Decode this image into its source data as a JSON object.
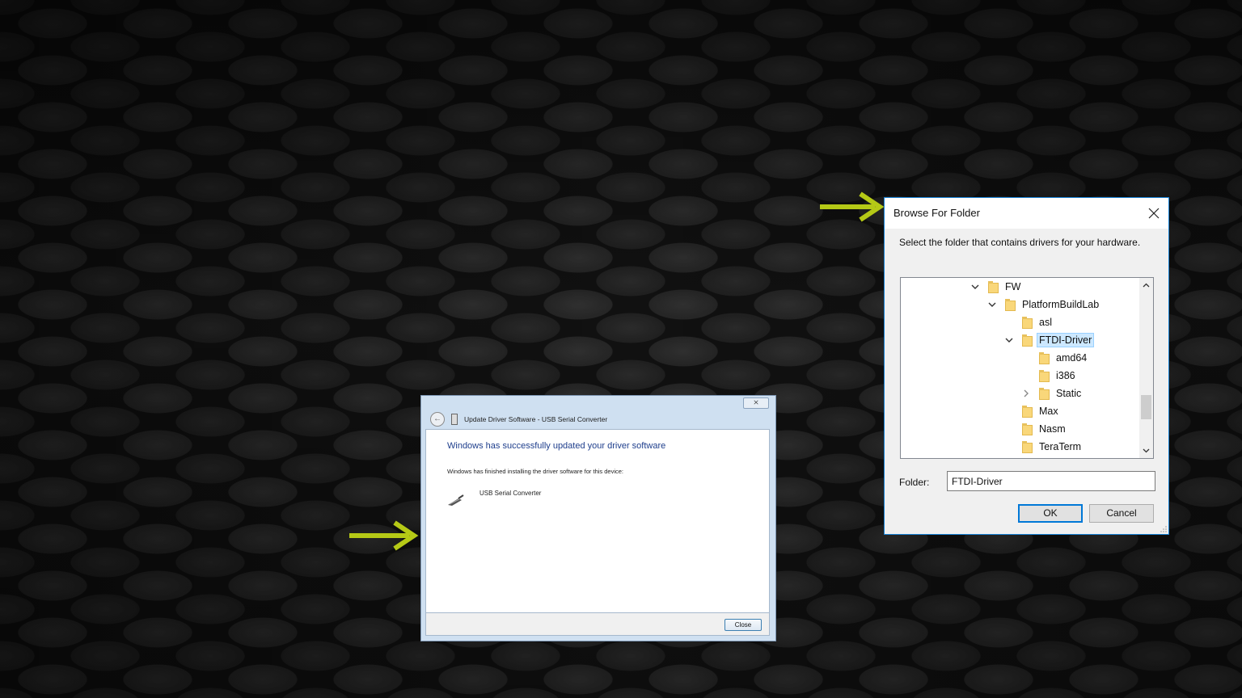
{
  "colors": {
    "arrow": "#b5c916",
    "win10_accent": "#0078d7",
    "win7_heading": "#1e3e8c"
  },
  "update_dialog": {
    "title": "Update Driver Software - USB Serial Converter",
    "heading": "Windows has successfully updated your driver software",
    "message": "Windows has finished installing the driver software for this device:",
    "device_name": "USB Serial Converter",
    "device_icon": "usb-cable-icon",
    "close_label": "Close",
    "close_icon": "close-icon"
  },
  "browse_dialog": {
    "title": "Browse For Folder",
    "description": "Select the folder that contains drivers for your hardware.",
    "tree": [
      {
        "label": "FW",
        "level": 0,
        "expander": "expanded",
        "selected": false
      },
      {
        "label": "PlatformBuildLab",
        "level": 1,
        "expander": "expanded",
        "selected": false
      },
      {
        "label": "asl",
        "level": 2,
        "expander": "none",
        "selected": false
      },
      {
        "label": "FTDI-Driver",
        "level": 2,
        "expander": "expanded",
        "selected": true
      },
      {
        "label": "amd64",
        "level": 3,
        "expander": "none",
        "selected": false
      },
      {
        "label": "i386",
        "level": 3,
        "expander": "none",
        "selected": false
      },
      {
        "label": "Static",
        "level": 3,
        "expander": "collapsed",
        "selected": false
      },
      {
        "label": "Max",
        "level": 2,
        "expander": "none",
        "selected": false
      },
      {
        "label": "Nasm",
        "level": 2,
        "expander": "none",
        "selected": false
      },
      {
        "label": "TeraTerm",
        "level": 2,
        "expander": "none",
        "selected": false
      }
    ],
    "folder_label": "Folder:",
    "folder_value": "FTDI-Driver",
    "ok_label": "OK",
    "cancel_label": "Cancel"
  }
}
